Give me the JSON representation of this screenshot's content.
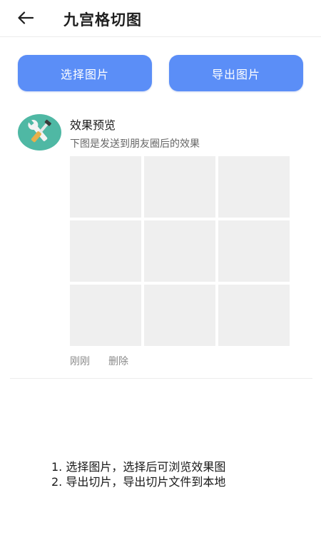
{
  "header": {
    "title": "九宫格切图",
    "back_icon": "arrow-left-icon"
  },
  "actions": {
    "select_label": "选择图片",
    "export_label": "导出图片",
    "accent_color": "#5b8ef7"
  },
  "preview": {
    "avatar_icon": "tools-icon",
    "name": "效果预览",
    "description": "下图是发送到朋友圈后的效果",
    "grid_cell_count": 9,
    "time": "刚刚",
    "delete_label": "删除"
  },
  "instructions": [
    "1. 选择图片，选择后可浏览效果图",
    "2. 导出切片，导出切片文件到本地"
  ]
}
